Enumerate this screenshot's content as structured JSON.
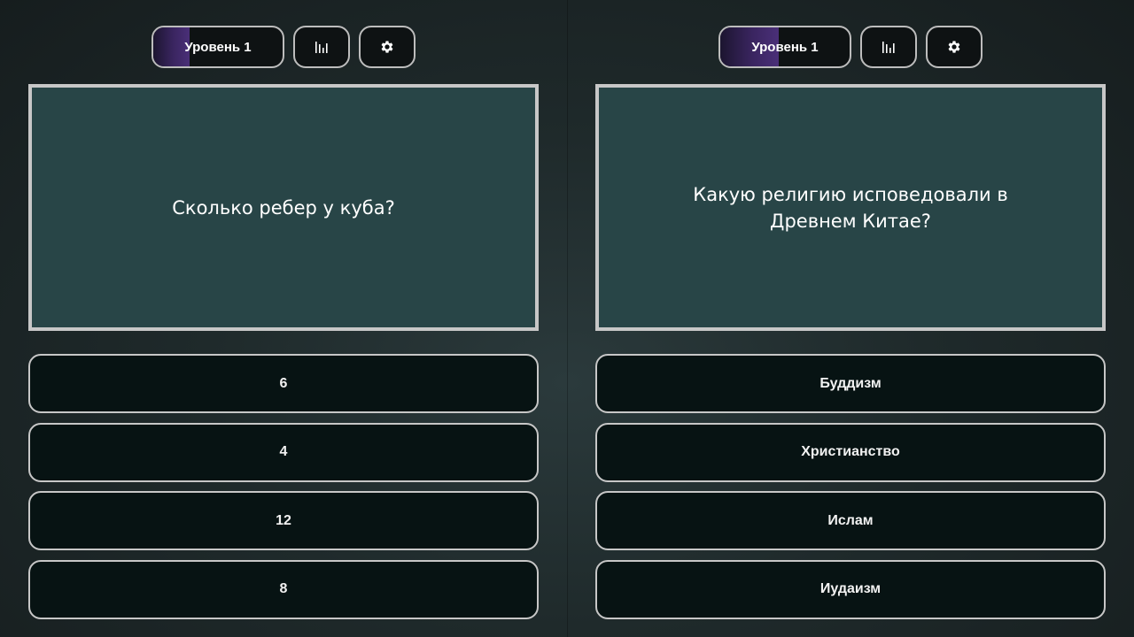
{
  "panels": [
    {
      "level": {
        "label": "Уровень 1",
        "progress": 0.28
      },
      "stats_icon": "bar-chart-icon",
      "settings_icon": "gear-icon",
      "question": "Сколько ребер у куба?",
      "answers": [
        "6",
        "4",
        "12",
        "8"
      ]
    },
    {
      "level": {
        "label": "Уровень 1",
        "progress": 0.45
      },
      "stats_icon": "bar-chart-icon",
      "settings_icon": "gear-icon",
      "question": "Какую религию исповедовали в Древнем Китае?",
      "answers": [
        "Буддизм",
        "Христианство",
        "Ислам",
        "Иудаизм"
      ]
    }
  ],
  "colors": {
    "level_fill": "#3a2560",
    "question_bg": "#284547",
    "answer_bg": "#071313",
    "border": "#c7c7c7"
  }
}
